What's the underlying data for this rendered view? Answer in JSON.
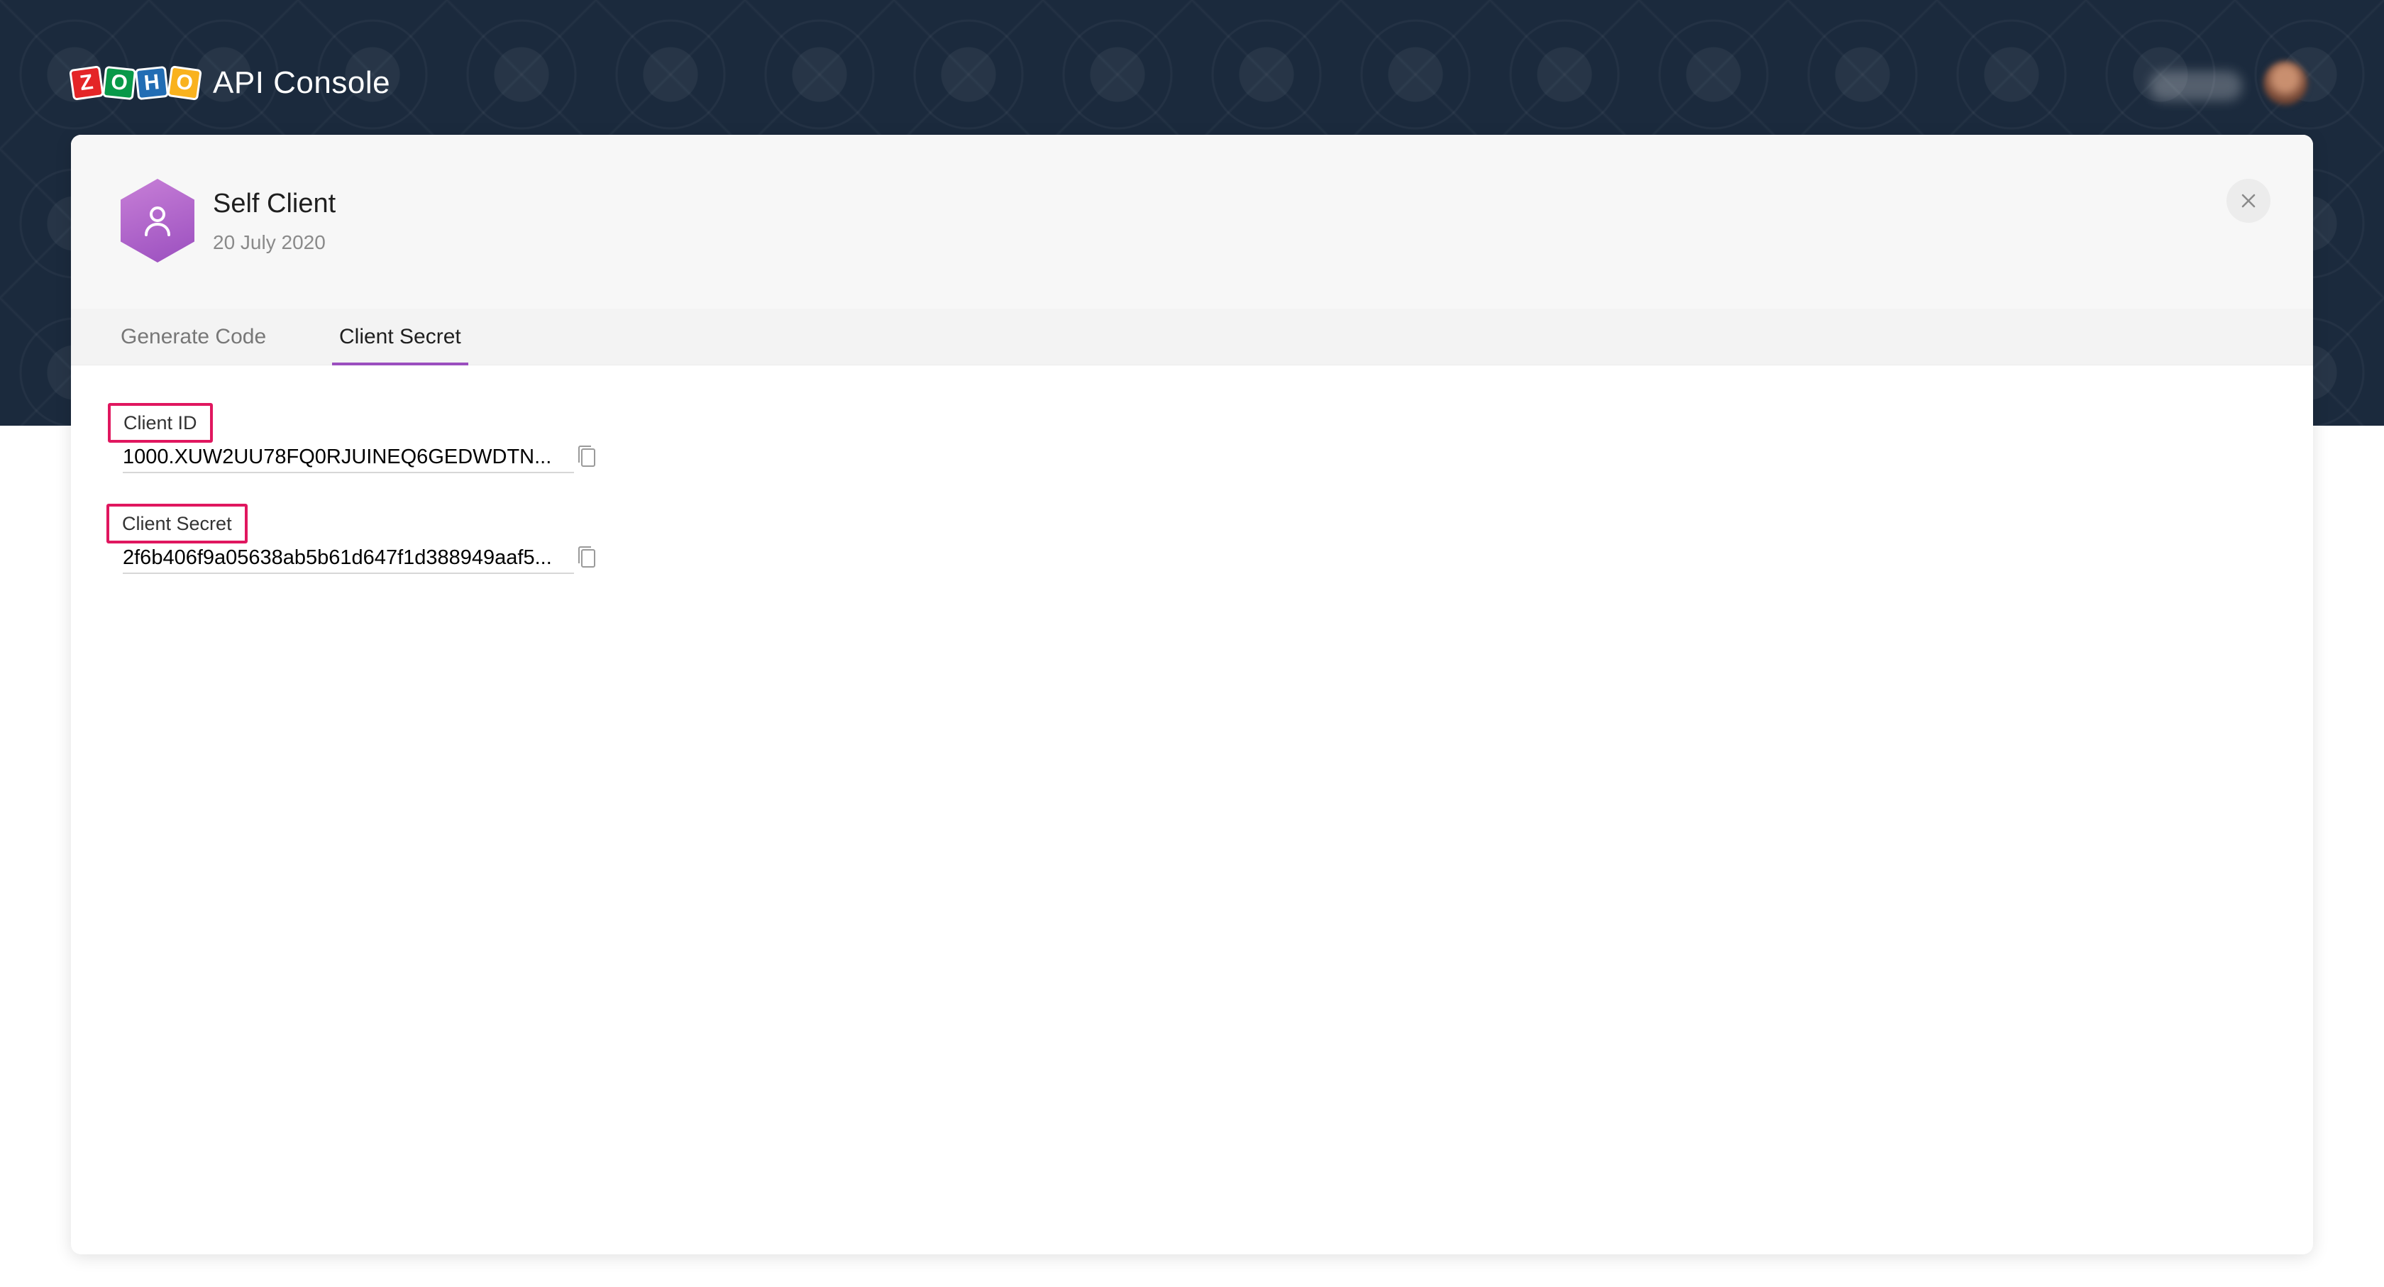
{
  "header": {
    "brand_letters": [
      "Z",
      "O",
      "H",
      "O"
    ],
    "app_title": "API Console"
  },
  "client": {
    "name": "Self Client",
    "date": "20 July 2020",
    "icon": "user-icon",
    "icon_gradient": [
      "#c77fd7",
      "#9b4fbf"
    ]
  },
  "tabs": [
    {
      "label": "Generate Code",
      "active": false
    },
    {
      "label": "Client Secret",
      "active": true
    }
  ],
  "fields": {
    "client_id": {
      "label": "Client ID",
      "value": "1000.XUW2UU78FQ0RJUINEQ6GEDWDTN..."
    },
    "client_secret": {
      "label": "Client Secret",
      "value": "2f6b406f9a05638ab5b61d647f1d388949aaf5..."
    }
  },
  "colors": {
    "accent": "#9b4fbf",
    "highlight": "#e0175f",
    "hero_bg": "#1b2a3d"
  },
  "icons": {
    "close": "close-icon",
    "copy": "copy-icon"
  }
}
